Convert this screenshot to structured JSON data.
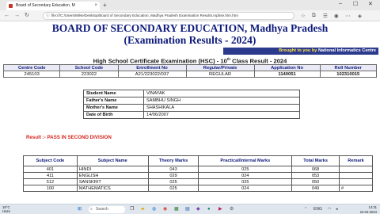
{
  "browser": {
    "tab_title": "Board of Secondary Education, M",
    "tab_close": "×",
    "new_tab": "+",
    "address": "file:///C:/Users/MiNe/Desktop/Board of Secondary Education, Madhya Pradesh Examination Results.mpbse.htm.htm",
    "win_minimize": "–",
    "win_maximize": "☐",
    "win_close": "✕"
  },
  "page": {
    "board_title": "BOARD OF SECONDARY EDUCATION, Madhya Pradesh",
    "board_subtitle": "(Examination Results - 2024)",
    "brought_by_prefix": "Brought to you by",
    "brought_by_name": "National Informatics Centre",
    "exam_title_pre": "High School Certificate Examination (HSC) - 10",
    "exam_title_sup": "th",
    "exam_title_post": " Class Result - 2024"
  },
  "header_table": {
    "columns": [
      "Centre Code",
      "School Code",
      "Enrollment No",
      "Regular/Private",
      "Application No",
      "Roll Number"
    ],
    "values": [
      "245103",
      "223022",
      "A21/223022/037",
      "REGULAR",
      "1140051",
      "102310015"
    ]
  },
  "student": {
    "name_label": "Student Name",
    "name": "VINAYAK",
    "father_label": "Father's Name",
    "father": "SAMBHU SINGH",
    "mother_label": "Mother's Name",
    "mother": "SHASHIKALA",
    "dob_label": "Date of Birth",
    "dob": "14/06/2007"
  },
  "result_text": "Result :- PASS IN SECOND DIVISION",
  "marks_table": {
    "columns": [
      "Subject Code",
      "Subject Name",
      "Theory Marks",
      "Practical/Internal Marks",
      "Total Marks",
      "Remark"
    ],
    "rows": [
      {
        "code": "401",
        "name": "HINDI",
        "theory": "043",
        "practical": "025",
        "total": "068",
        "remark": ""
      },
      {
        "code": "411",
        "name": "ENGLISH",
        "theory": "029",
        "practical": "024",
        "total": "053",
        "remark": ""
      },
      {
        "code": "512",
        "name": "SANSKRIT",
        "theory": "025",
        "practical": "025",
        "total": "050",
        "remark": ""
      },
      {
        "code": "100",
        "name": "MATHEMATICS",
        "theory": "025",
        "practical": "024",
        "total": "049",
        "remark": "#"
      }
    ]
  },
  "taskbar": {
    "weather_temp": "18°C",
    "weather_desc": "Haze",
    "search_placeholder": "Search",
    "time": "14:31",
    "date": "24-04-2024",
    "lang": "ENG"
  }
}
